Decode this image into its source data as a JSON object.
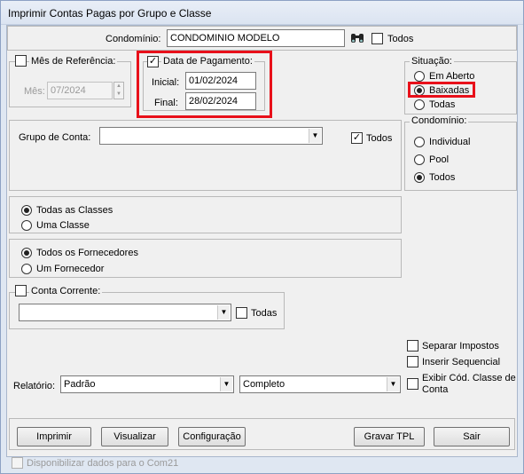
{
  "window": {
    "title": "Imprimir Contas Pagas por Grupo e Classe"
  },
  "condominio": {
    "label": "Condomínio:",
    "value": "CONDOMINIO MODELO",
    "search_icon": "binoculars-icon",
    "todos_label": "Todos",
    "todos_checked": false
  },
  "mes_referencia": {
    "label": "Mês de Referência:",
    "checked": false,
    "mes_label": "Mês:",
    "mes_value": "07/2024"
  },
  "data_pagamento": {
    "label": "Data de Pagamento:",
    "checked": true,
    "inicial_label": "Inicial:",
    "inicial_value": "01/02/2024",
    "final_label": "Final:",
    "final_value": "28/02/2024"
  },
  "situacao": {
    "label": "Situação:",
    "options": [
      "Em Aberto",
      "Baixadas",
      "Todas"
    ],
    "selected": "Baixadas"
  },
  "condominio_tipo": {
    "label": "Condomínio:",
    "options": [
      "Individual",
      "Pool",
      "Todos"
    ],
    "selected": "Todos"
  },
  "grupo_conta": {
    "label": "Grupo de Conta:",
    "value": "",
    "todos_label": "Todos",
    "todos_checked": true
  },
  "classes": {
    "options": [
      "Todas as Classes",
      "Uma Classe"
    ],
    "selected": "Todas as Classes"
  },
  "fornecedores": {
    "options": [
      "Todos os Fornecedores",
      "Um Fornecedor"
    ],
    "selected": "Todos os Fornecedores"
  },
  "conta_corrente": {
    "label": "Conta Corrente:",
    "checked": false,
    "value": "",
    "todas_label": "Todas",
    "todas_checked": false
  },
  "opcoes": {
    "separar_impostos": "Separar Impostos",
    "inserir_sequencial": "Inserir Sequencial",
    "exibir_cod_line1": "Exibir Cód. Classe de",
    "exibir_cod_line2": "Conta"
  },
  "relatorio": {
    "label": "Relatório:",
    "value": "Padrão",
    "tipo_value": "Completo"
  },
  "buttons": {
    "imprimir": "Imprimir",
    "visualizar": "Visualizar",
    "configuracao": "Configuração",
    "gravar_tpl": "Gravar TPL",
    "sair": "Sair"
  },
  "footer": {
    "com21_label": "Disponibilizar dados para o Com21",
    "com21_checked": false
  },
  "colors": {
    "highlight": "#e8101a",
    "title_bg": "#dbe4f1"
  }
}
